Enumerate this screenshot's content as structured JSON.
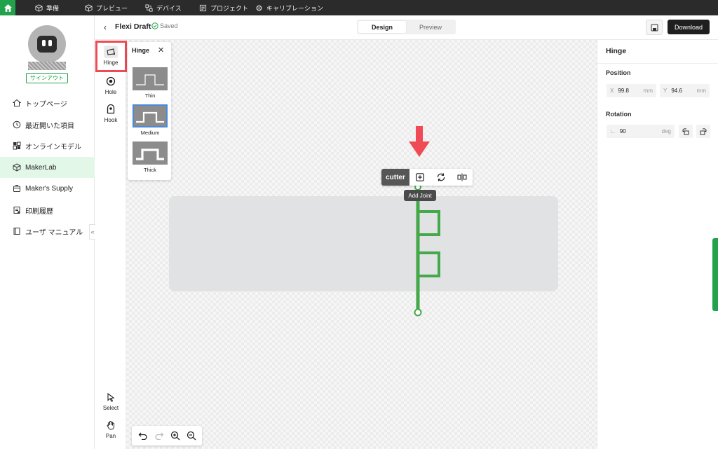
{
  "menu": {
    "items": [
      {
        "label": "準備",
        "icon": "box-icon"
      },
      {
        "label": "プレビュー",
        "icon": "cube-icon"
      },
      {
        "label": "デバイス",
        "icon": "devices-icon"
      },
      {
        "label": "プロジェクト",
        "icon": "project-icon"
      },
      {
        "label": "キャリブレーション",
        "icon": "calibration-icon"
      }
    ]
  },
  "sidebar": {
    "signout_label": "サインアウト",
    "items": [
      {
        "label": "トップページ",
        "icon": "home-icon"
      },
      {
        "label": "最近開いた項目",
        "icon": "clock-icon"
      },
      {
        "label": "オンラインモデル",
        "icon": "grid-icon"
      },
      {
        "label": "MakerLab",
        "icon": "makerlab-icon"
      },
      {
        "label": "Maker's Supply",
        "icon": "supply-icon"
      },
      {
        "label": "印刷履歴",
        "icon": "history-icon"
      },
      {
        "label": "ユーザ マニュアル",
        "icon": "book-icon"
      }
    ],
    "collapse_glyph": "«"
  },
  "header": {
    "back_glyph": "‹",
    "title": "Flexi Draft",
    "saved_label": "Saved",
    "tabs": {
      "design": "Design",
      "preview": "Preview"
    },
    "download_label": "Download"
  },
  "tools": {
    "hinge": "Hinge",
    "hole": "Hole",
    "hook": "Hook",
    "select": "Select",
    "pan": "Pan"
  },
  "hinge_panel": {
    "title": "Hinge",
    "close_glyph": "✕",
    "options": [
      "Thin",
      "Medium",
      "Thick"
    ]
  },
  "canvas": {
    "cutter_label": "cutter",
    "tooltip": "Add Joint"
  },
  "right_panel": {
    "title": "Hinge",
    "position_label": "Position",
    "x_label": "X",
    "x_value": "99.8",
    "x_unit": "mm",
    "y_label": "Y",
    "y_value": "94.6",
    "y_unit": "mm",
    "rotation_label": "Rotation",
    "rotation_value": "90",
    "rotation_unit": "deg"
  },
  "colors": {
    "accent": "#21a24b",
    "highlight": "#ef4a55",
    "hinge_line": "#45a84a"
  }
}
